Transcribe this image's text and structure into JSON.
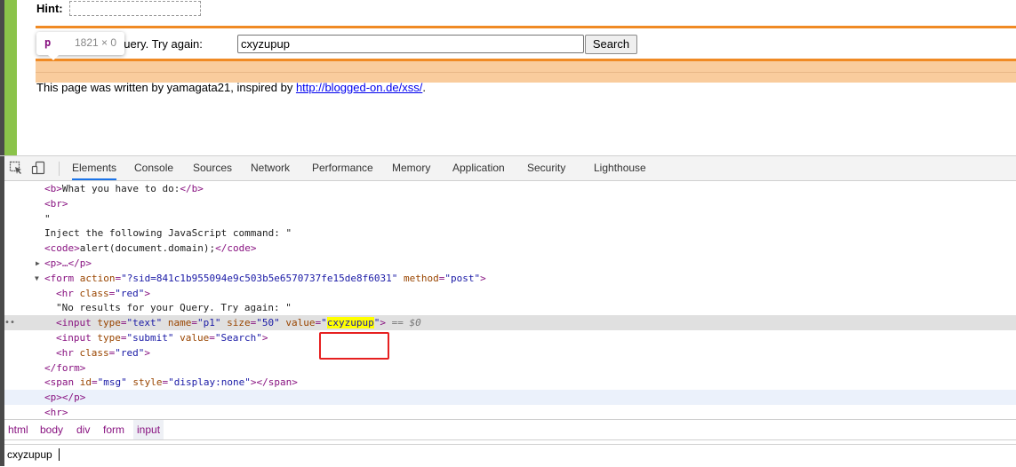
{
  "page": {
    "hint_label": "Hint:",
    "query_prompt": "No results for your Query. Try again:",
    "query_prompt_visible": "ur Query. Try again:",
    "input_value": "cxyzupup",
    "search_button": "Search",
    "footer_prefix": "This page was written by yamagata21, inspired by ",
    "footer_link": "http://blogged-on.de/xss/",
    "footer_suffix": ".",
    "accent_color": "#f08a24",
    "tooltip": {
      "tag": "p",
      "dimensions": "1821 × 0"
    }
  },
  "devtools": {
    "toolbar_icons": [
      "inspect-icon",
      "device-toggle-icon"
    ],
    "tabs": [
      "Elements",
      "Console",
      "Sources",
      "Network",
      "Performance",
      "Memory",
      "Application",
      "Security",
      "Lighthouse"
    ],
    "active_tab": "Elements",
    "dom_lines": {
      "l1_open": "<b>",
      "l1_text": "What you have to do:",
      "l1_close": "</b>",
      "l2": "<br>",
      "l3": "\"",
      "l4": "Inject the following JavaScript command: \"",
      "l5_open": "<code>",
      "l5_text": "alert(document.domain);",
      "l5_close": "</code>",
      "l6": "<p>…</p>",
      "l7_tag": "<form",
      "l7_attr1": "action",
      "l7_val1": "\"?sid=841c1b955094e9c503b5e6570737fe15de8f6031\"",
      "l7_attr2": "method",
      "l7_val2": "\"post\"",
      "l7_end": ">",
      "l8_tag": "<hr",
      "l8_attr": "class",
      "l8_val": "\"red\"",
      "l8_end": ">",
      "l9": "\"No results for your Query. Try again: \"",
      "l10_tag": "<input",
      "l10_a1": "type",
      "l10_v1": "\"text\"",
      "l10_a2": "name",
      "l10_v2": "\"p1\"",
      "l10_a3": "size",
      "l10_v3": "\"50\"",
      "l10_a4": "value",
      "l10_q1": "\"",
      "l10_v4": "cxyzupup",
      "l10_q2": "\"",
      "l10_end": ">",
      "l10_marker": " == $0",
      "l11_tag": "<input",
      "l11_a1": "type",
      "l11_v1": "\"submit\"",
      "l11_a2": "value",
      "l11_v2": "\"Search\"",
      "l11_end": ">",
      "l12_tag": "<hr",
      "l12_attr": "class",
      "l12_val": "\"red\"",
      "l12_end": ">",
      "l13": "</form>",
      "l14_tag": "<span",
      "l14_a1": "id",
      "l14_v1": "\"msg\"",
      "l14_a2": "style",
      "l14_v2": "\"display:none\"",
      "l14_end": "></span>",
      "l15": "<p></p>",
      "l16": "<hr>"
    },
    "selected_dots": "••",
    "breadcrumbs": [
      "html",
      "body",
      "div",
      "form",
      "input"
    ],
    "active_breadcrumb": "input",
    "console_input": "cxyzupup"
  }
}
